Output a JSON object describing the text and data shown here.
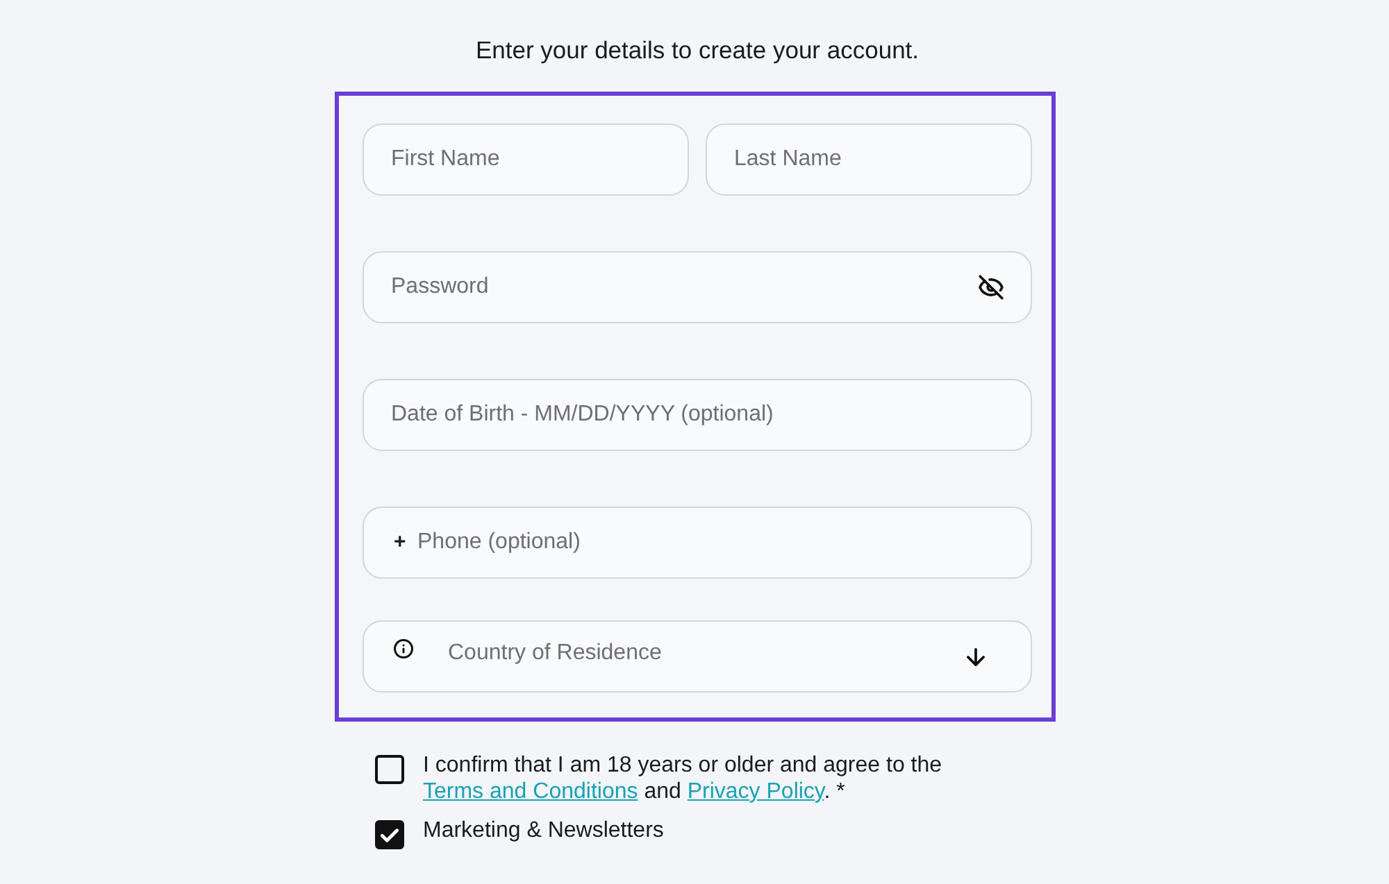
{
  "heading": "Enter your details to create your account.",
  "name_row": [
    {
      "placeholder": "First Name"
    },
    {
      "placeholder": "Last Name"
    }
  ],
  "fields": [
    {
      "kind": "password",
      "placeholder": "Password"
    },
    {
      "kind": "date",
      "placeholder": "Date of Birth - MM/DD/YYYY (optional)"
    },
    {
      "kind": "phone",
      "prefix": "+",
      "placeholder": "Phone (optional)"
    },
    {
      "kind": "select",
      "placeholder": "Country of Residence"
    }
  ],
  "consents": [
    {
      "checked": false,
      "segments": [
        {
          "kind": "text",
          "text": "I confirm that I am 18 years or older and agree to the "
        },
        {
          "kind": "link",
          "text": "Terms and Conditions"
        },
        {
          "kind": "text",
          "text": " and "
        },
        {
          "kind": "link",
          "text": "Privacy Policy"
        },
        {
          "kind": "text",
          "text": ". *"
        }
      ]
    },
    {
      "checked": true,
      "segments": [
        {
          "kind": "text",
          "text": "Marketing & Newsletters"
        }
      ]
    }
  ]
}
